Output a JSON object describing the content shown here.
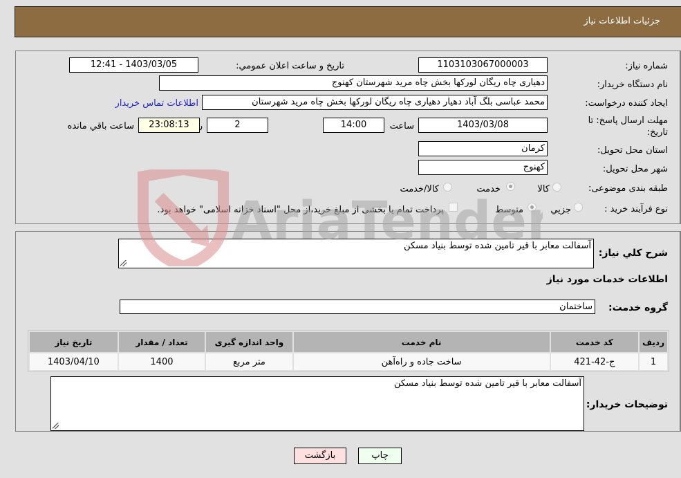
{
  "header": {
    "title": "جزئیات اطلاعات نیاز"
  },
  "form": {
    "need_number_label": "شماره نیاز:",
    "need_number": "1103103067000003",
    "announce_label": "تاریخ و ساعت اعلان عمومي:",
    "announce_value": "1403/03/05 - 12:41",
    "buyer_org_label": "نام دستگاه خریدار:",
    "buyer_org": "دهیاری چاه ریگان لورکها بخش چاه مرید شهرستان کهنوج",
    "creator_label": "ایجاد کننده درخواست:",
    "creator": "محمد عباسی بلگ آباد دهیار دهیاری چاه ریگان لورکها بخش چاه مرید شهرستان",
    "contact_link": "اطلاعات تماس خریدار",
    "deadline_label": "مهلت ارسال پاسخ: تا تاریخ:",
    "deadline_date": "1403/03/08",
    "time_label": "ساعت",
    "deadline_time": "14:00",
    "days_value": "2",
    "days_label": "روز و",
    "remaining_time": "23:08:13",
    "remaining_label": "ساعت باقي مانده",
    "province_label": "استان محل تحویل:",
    "province": "کرمان",
    "city_label": "شهر محل تحویل:",
    "city": "کهنوج",
    "category_label": "طبقه بندی موضوعی:",
    "category_options": [
      {
        "label": "کالا",
        "checked": false
      },
      {
        "label": "خدمت",
        "checked": true
      },
      {
        "label": "کالا/خدمت",
        "checked": false
      }
    ],
    "process_label": "نوع فرآیند خرید :",
    "process_options": [
      {
        "label": "جزيي",
        "checked": false
      },
      {
        "label": "متوسط",
        "checked": true
      }
    ],
    "treasury_note": "پرداخت تمام یا بخشی از مبلغ خرید،از محل \"اسناد خزانه اسلامی\" خواهد بود."
  },
  "details": {
    "summary_label": "شرح کلي نیاز:",
    "summary": "آسفالت معابر با قیر تامین شده توسط بنیاد مسکن",
    "services_heading": "اطلاعات خدمات مورد نیاز",
    "service_group_label": "گروه خدمت:",
    "service_group": "ساختمان",
    "table": {
      "headers": [
        "ردیف",
        "کد خدمت",
        "نام خدمت",
        "واحد اندازه گیری",
        "تعداد / مقدار",
        "تاریخ نیاز"
      ],
      "rows": [
        [
          "1",
          "ج-42-421",
          "ساخت جاده و راه‌آهن",
          "متر مربع",
          "1400",
          "1403/04/10"
        ]
      ]
    },
    "buyer_notes_label": "توضیحات خریدار:",
    "buyer_notes": "آسفالت معابر با قیر تامین شده توسط بنیاد مسکن"
  },
  "buttons": {
    "print": "چاپ",
    "back": "بازگشت"
  },
  "watermark": {
    "text": "AriaTender.neT"
  }
}
